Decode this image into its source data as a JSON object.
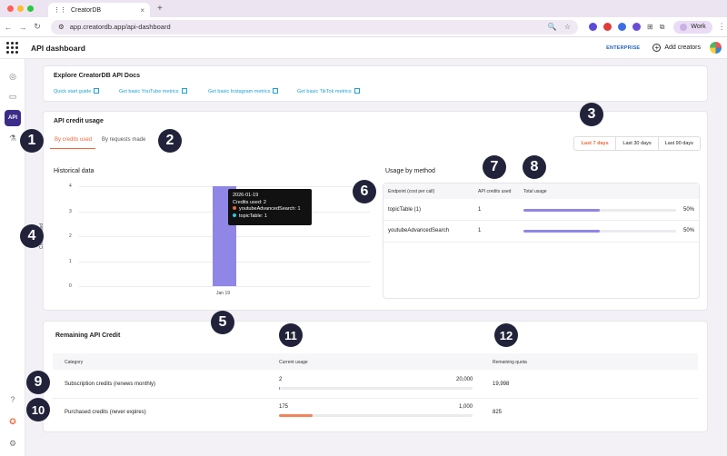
{
  "browser": {
    "tab_title": "CreatorDB",
    "url": "app.creatordb.app/api-dashboard",
    "profile": "Work"
  },
  "header": {
    "title": "API dashboard",
    "plan_badge": "ENTERPRISE",
    "add_creators": "Add creators"
  },
  "sidebar": {
    "active_label": "API"
  },
  "docs": {
    "title": "Explore CreatorDB API Docs",
    "links": [
      "Quick start guide",
      "Get basic YouTube metrics",
      "Get basic Instagram metrics",
      "Get basic TikTok metrics"
    ]
  },
  "credit_usage": {
    "title": "API credit usage",
    "tabs": [
      "By credits used",
      "By requests made"
    ],
    "ranges": [
      "Last 7 days",
      "Last 30 days",
      "Last 90 days"
    ],
    "historical_title": "Historical data",
    "tooltip": {
      "date": "2026-01-19",
      "credits": "Credits used: 2",
      "lines": [
        "youtubeAdvancedSearch: 1",
        "topicTable: 1"
      ]
    }
  },
  "chart_data": {
    "type": "bar",
    "categories": [
      "Jan 19"
    ],
    "values": [
      4
    ],
    "ylabel": "Credits used",
    "ylim": [
      0,
      4
    ],
    "yticks": [
      "0",
      "1",
      "2",
      "3",
      "4"
    ],
    "color": "#8f86e6"
  },
  "usage_by_method": {
    "title": "Usage by method",
    "columns": [
      "Endpoint (cost per call)",
      "API credits used",
      "Total usage"
    ],
    "rows": [
      {
        "endpoint": "topicTable (1)",
        "credits": "1",
        "usage_pct": 50,
        "usage_label": "50%"
      },
      {
        "endpoint": "youtubeAdvancedSearch",
        "credits": "1",
        "usage_pct": 50,
        "usage_label": "50%"
      }
    ]
  },
  "remaining": {
    "title": "Remaining API Credit",
    "columns": [
      "Category",
      "Current usage",
      "Remaining quota"
    ],
    "rows": [
      {
        "category": "Subscription credits (renews monthly)",
        "used": "2",
        "total": "20,000",
        "fraction": 0.0001,
        "remaining": "19,998",
        "color": "#8f86e6"
      },
      {
        "category": "Purchased credits (never expires)",
        "used": "175",
        "total": "1,000",
        "fraction": 0.175,
        "remaining": "825",
        "color": "#f0845b"
      }
    ]
  },
  "markers": [
    "1",
    "2",
    "3",
    "4",
    "5",
    "6",
    "7",
    "8",
    "9",
    "10",
    "11",
    "12"
  ]
}
